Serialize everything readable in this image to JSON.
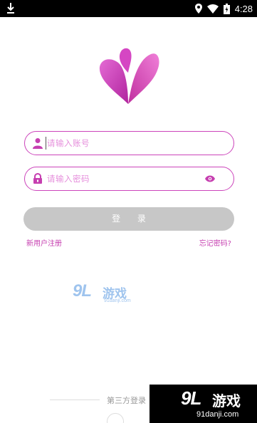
{
  "status_bar": {
    "time": "4:28",
    "icons": [
      "download-icon",
      "location-icon",
      "wifi-icon",
      "battery-icon"
    ]
  },
  "app": {
    "logo": "heart-petal-logo",
    "brand_colors": {
      "primary": "#cc44bb",
      "placeholder": "#e68fdc",
      "button_disabled": "#c7c7c7"
    }
  },
  "form": {
    "account": {
      "placeholder": "请输入账号",
      "icon": "user-icon"
    },
    "password": {
      "placeholder": "请输入密码",
      "icon": "lock-icon",
      "toggle_icon": "eye-icon"
    },
    "login_label": "登 录"
  },
  "links": {
    "register": "新用户注册",
    "forgot": "忘记密码?"
  },
  "third_party": {
    "label": "第三方登录"
  },
  "watermark": {
    "mid_big": "9L",
    "mid_cn": "游戏",
    "mid_url": "91danji.com",
    "corner_big": "9L",
    "corner_cn": "游戏",
    "corner_url": "91danji.com"
  }
}
